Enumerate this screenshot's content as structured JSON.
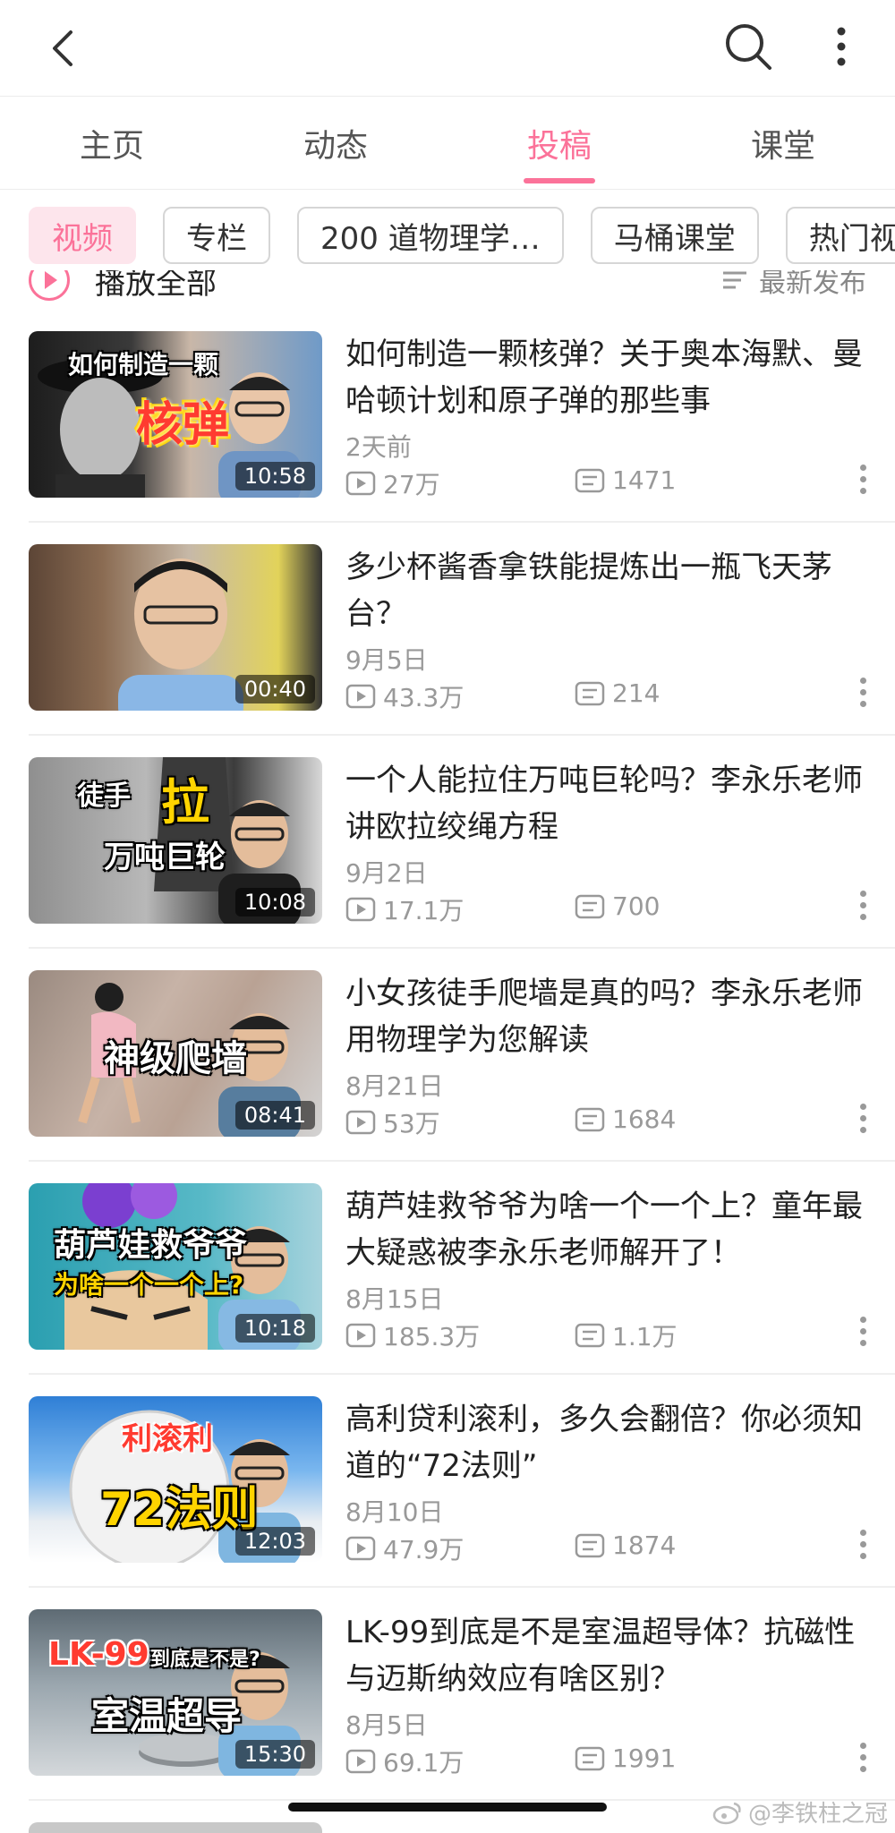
{
  "tabs": [
    {
      "label": "主页"
    },
    {
      "label": "动态"
    },
    {
      "label": "投稿",
      "active": true
    },
    {
      "label": "课堂"
    }
  ],
  "chips": [
    {
      "label": "视频",
      "active": true
    },
    {
      "label": "专栏"
    },
    {
      "label": "200 道物理学…"
    },
    {
      "label": "马桶课堂"
    },
    {
      "label": "热门视"
    }
  ],
  "play_all": {
    "label": "播放全部",
    "sort_label": "最新发布"
  },
  "videos": [
    {
      "title": "如何制造一颗核弹？关于奥本海默、曼哈顿计划和原子弹的那些事",
      "date": "2天前",
      "plays": "27万",
      "danmaku": "1471",
      "duration": "10:58",
      "thumb_line1": "如何制造一颗",
      "thumb_line2": "核弹"
    },
    {
      "title": "多少杯酱香拿铁能提炼出一瓶飞天茅台？",
      "date": "9月5日",
      "plays": "43.3万",
      "danmaku": "214",
      "duration": "00:40"
    },
    {
      "title": "一个人能拉住万吨巨轮吗？李永乐老师讲欧拉绞绳方程",
      "date": "9月2日",
      "plays": "17.1万",
      "danmaku": "700",
      "duration": "10:08",
      "thumb_line1": "徒手",
      "thumb_line2": "拉",
      "thumb_line3": "万吨巨轮"
    },
    {
      "title": "小女孩徒手爬墙是真的吗？李永乐老师用物理学为您解读",
      "date": "8月21日",
      "plays": "53万",
      "danmaku": "1684",
      "duration": "08:41",
      "thumb_line1": "神级爬墙"
    },
    {
      "title": "葫芦娃救爷爷为啥一个一个上？童年最大疑惑被李永乐老师解开了！",
      "date": "8月15日",
      "plays": "185.3万",
      "danmaku": "1.1万",
      "duration": "10:18",
      "thumb_line1": "葫芦娃救爷爷",
      "thumb_line2": "为啥一个一个上?"
    },
    {
      "title": "高利贷利滚利，多久会翻倍？你必须知道的“72法则”",
      "date": "8月10日",
      "plays": "47.9万",
      "danmaku": "1874",
      "duration": "12:03",
      "thumb_line1": "利滚利",
      "thumb_line2": "72法则"
    },
    {
      "title": "LK-99到底是不是室温超导体？抗磁性与迈斯纳效应有啥区别？",
      "date": "8月5日",
      "plays": "69.1万",
      "danmaku": "1991",
      "duration": "15:30",
      "thumb_line1": "LK-99",
      "thumb_line2": "到底是不是?",
      "thumb_line3": "室温超导"
    }
  ],
  "watermark": "@李铁柱之冠",
  "colors": {
    "accent": "#fb7299",
    "muted": "#999999"
  }
}
